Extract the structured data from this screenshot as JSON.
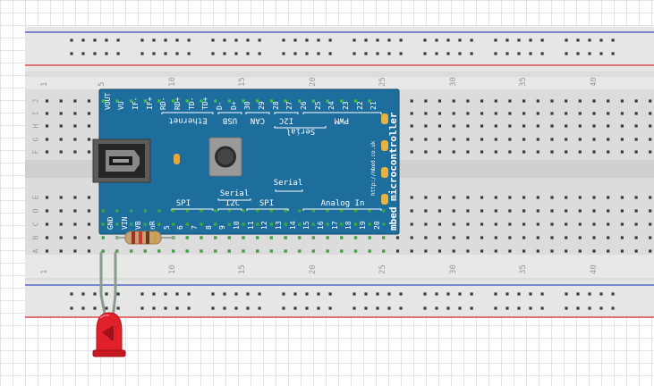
{
  "breadboard": {
    "row_letters_top": [
      "J",
      "I",
      "H",
      "G",
      "F"
    ],
    "row_letters_bottom": [
      "E",
      "D",
      "C",
      "B",
      "A"
    ],
    "column_numbers": [
      "1",
      "5",
      "10",
      "15",
      "20",
      "25",
      "30",
      "35",
      "40"
    ]
  },
  "mbed": {
    "top_pins": [
      "VOUT",
      "VU",
      "IF-",
      "IF+",
      "RD-",
      "RD+",
      "TD-",
      "TD+",
      "D-",
      "D+",
      "30",
      "29",
      "28",
      "27",
      "26",
      "25",
      "24",
      "23",
      "22",
      "21"
    ],
    "bottom_pins": [
      "GND",
      "VIN",
      "VB",
      "nR",
      "5",
      "6",
      "7",
      "8",
      "9",
      "10",
      "11",
      "12",
      "13",
      "14",
      "15",
      "16",
      "17",
      "18",
      "19",
      "20"
    ],
    "top_groups": [
      "Ethernet",
      "USB",
      "CAN",
      "I2C",
      "PWM"
    ],
    "top_serial": "Serial",
    "bottom_groups": [
      "SPI",
      "I2C",
      "SPI",
      "Analog In"
    ],
    "bottom_serial_left": "Serial",
    "bottom_serial_right": "Serial",
    "url": "http://mbed.co.uk",
    "brand": "mbed microcontroller"
  },
  "colors": {
    "board_blue": "#1d6e9c",
    "led_red": "#e0202a",
    "rail_red": "#d8312f",
    "rail_blue": "#3a4fc4",
    "wire_gray": "#8c9a8c",
    "connected_green": "#3da63d"
  }
}
